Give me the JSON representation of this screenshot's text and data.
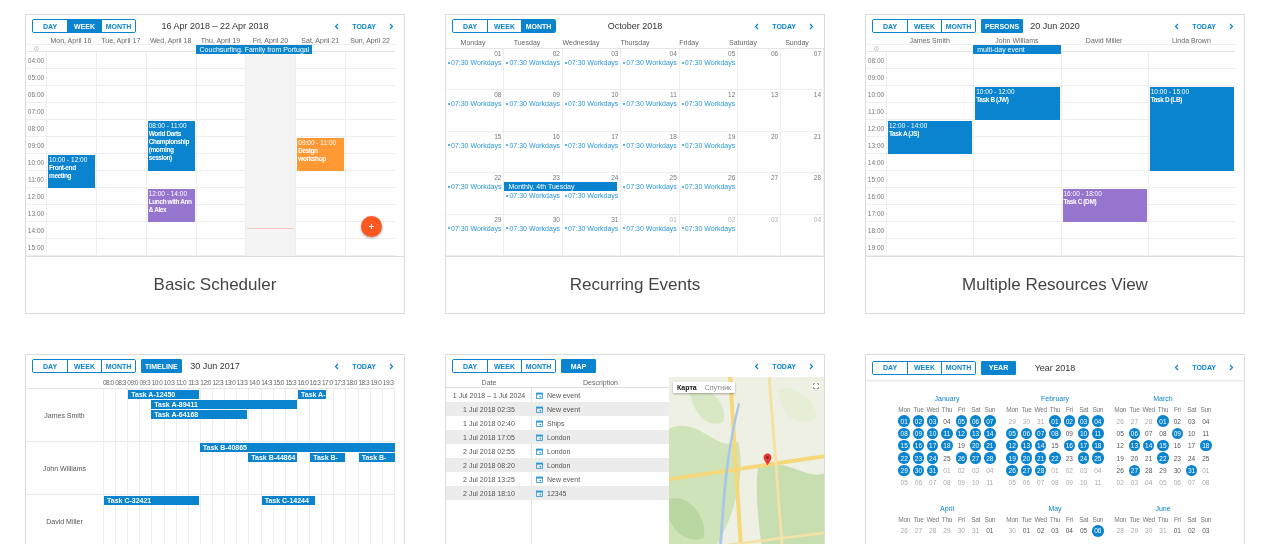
{
  "cards": [
    {
      "kind": "week",
      "caption": "Basic Scheduler",
      "toolbar": {
        "views": [
          {
            "label": "DAY",
            "selected": false
          },
          {
            "label": "WEEK",
            "selected": true
          },
          {
            "label": "MONTH",
            "selected": false
          }
        ],
        "title": "16 Apr 2018 – 22 Apr 2018",
        "today": "TODAY"
      },
      "hours": [
        "04:00",
        "05:00",
        "06:00",
        "07:00",
        "08:00",
        "09:00",
        "10:00",
        "11:00",
        "12:00",
        "13:00",
        "14:00",
        "15:00"
      ],
      "columns": [
        {
          "label": "Mon, April 16",
          "today": false,
          "events": [
            {
              "time": "10:00 - 12:00",
              "title": "Front-end meeting",
              "color": "#0a84cf"
            }
          ]
        },
        {
          "label": "Tue, April 17",
          "today": false
        },
        {
          "label": "Wed, April 18",
          "today": false,
          "events": [
            {
              "time": "08:00 - 11:00",
              "title": "World Darts Championship (morning session)",
              "color": "#0a84cf"
            },
            {
              "time": "12:00 - 14:00",
              "title": "Lunch with Ann & Alex",
              "color": "#9575cd"
            }
          ]
        },
        {
          "label": "Thu, April 19",
          "today": false,
          "all_day": [
            "Couchsurfing. Family from Portugal"
          ]
        },
        {
          "label": "Fri, April 20",
          "today": true
        },
        {
          "label": "Sat, April 21",
          "today": false,
          "events": [
            {
              "time": "09:00 - 11:00",
              "title": "Design workshop",
              "color": "#ff9933"
            }
          ]
        },
        {
          "label": "Sun, April 22",
          "today": false
        }
      ]
    },
    {
      "kind": "month",
      "caption": "Recurring Events",
      "toolbar": {
        "views": [
          {
            "label": "DAY",
            "selected": false
          },
          {
            "label": "WEEK",
            "selected": false
          },
          {
            "label": "MONTH",
            "selected": true
          }
        ],
        "title": "October 2018",
        "today": "TODAY"
      },
      "weekdays": [
        "Monday",
        "Tuesday",
        "Wednesday",
        "Thursday",
        "Friday",
        "Saturday",
        "Sunday"
      ],
      "weeks": [
        {
          "days": [
            {
              "number": "01",
              "muted": false,
              "events": [
                "07:30 Workdays"
              ]
            },
            {
              "number": "02",
              "muted": false,
              "events": [
                "07:30 Workdays"
              ]
            },
            {
              "number": "03",
              "muted": false,
              "events": [
                "07:30 Workdays"
              ]
            },
            {
              "number": "04",
              "muted": false,
              "events": [
                "07:30 Workdays"
              ]
            },
            {
              "number": "05",
              "muted": false,
              "events": [
                "07:30 Workdays"
              ]
            },
            {
              "number": "06",
              "muted": false
            },
            {
              "number": "07",
              "muted": false
            }
          ]
        },
        {
          "days": [
            {
              "number": "08",
              "muted": false,
              "events": [
                "07:30 Workdays"
              ]
            },
            {
              "number": "09",
              "muted": false,
              "events": [
                "07:30 Workdays"
              ]
            },
            {
              "number": "10",
              "muted": false,
              "events": [
                "07:30 Workdays"
              ]
            },
            {
              "number": "11",
              "muted": false,
              "events": [
                "07:30 Workdays"
              ]
            },
            {
              "number": "12",
              "muted": false,
              "events": [
                "07:30 Workdays"
              ]
            },
            {
              "number": "13",
              "muted": false
            },
            {
              "number": "14",
              "muted": false
            }
          ]
        },
        {
          "days": [
            {
              "number": "15",
              "muted": false,
              "events": [
                "07:30 Workdays"
              ]
            },
            {
              "number": "16",
              "muted": false,
              "events": [
                "07:30 Workdays"
              ]
            },
            {
              "number": "17",
              "muted": false,
              "events": [
                "07:30 Workdays"
              ]
            },
            {
              "number": "18",
              "muted": false,
              "events": [
                "07:30 Workdays"
              ]
            },
            {
              "number": "19",
              "muted": false,
              "events": [
                "07:30 Workdays"
              ]
            },
            {
              "number": "20",
              "muted": false
            },
            {
              "number": "21",
              "muted": false
            }
          ]
        },
        {
          "days": [
            {
              "number": "22",
              "muted": false,
              "events": [
                "07:30 Workdays"
              ]
            },
            {
              "number": "23",
              "muted": false,
              "bar": "Monthly, 4th Tuesday",
              "events": [
                "07:30 Workdays"
              ]
            },
            {
              "number": "24",
              "muted": false,
              "events": [
                "07:30 Workdays"
              ]
            },
            {
              "number": "25",
              "muted": false,
              "events": [
                "07:30 Workdays"
              ]
            },
            {
              "number": "26",
              "muted": false,
              "events": [
                "07:30 Workdays"
              ]
            },
            {
              "number": "27",
              "muted": false
            },
            {
              "number": "28",
              "muted": false
            }
          ]
        },
        {
          "days": [
            {
              "number": "29",
              "muted": false,
              "events": [
                "07:30 Workdays"
              ]
            },
            {
              "number": "30",
              "muted": false,
              "events": [
                "07:30 Workdays"
              ]
            },
            {
              "number": "31",
              "muted": false,
              "events": [
                "07:30 Workdays"
              ]
            },
            {
              "number": "01",
              "muted": true,
              "events": [
                "07:30 Workdays"
              ]
            },
            {
              "number": "02",
              "muted": true,
              "events": [
                "07:30 Workdays"
              ]
            },
            {
              "number": "03",
              "muted": true
            },
            {
              "number": "04",
              "muted": true
            }
          ]
        }
      ]
    },
    {
      "kind": "persons",
      "caption": "Multiple Resources View",
      "toolbar": {
        "views": [
          {
            "label": "DAY",
            "selected": false
          },
          {
            "label": "WEEK",
            "selected": false
          },
          {
            "label": "MONTH",
            "selected": false
          }
        ],
        "extra_view": {
          "label": "PERSONS",
          "selected": true
        },
        "title": "20 Jun 2020",
        "today": "TODAY"
      },
      "hours": [
        "08:00",
        "09:00",
        "10:00",
        "11:00",
        "12:00",
        "13:00",
        "14:00",
        "15:00",
        "16:00",
        "17:00",
        "18:00",
        "19:00"
      ],
      "columns": [
        {
          "label": "James Smith",
          "events": [
            {
              "time": "12:00 - 14:00",
              "title": "Task A (JS)",
              "color": "#0a84cf"
            }
          ]
        },
        {
          "label": "John Williams",
          "all_day": [
            "multi-day event"
          ],
          "events": [
            {
              "time": "10:00 - 12:00",
              "title": "Task B (JW)",
              "color": "#0a84cf"
            }
          ]
        },
        {
          "label": "David Miller",
          "events": [
            {
              "time": "16:00 - 18:00",
              "title": "Task C (DM)",
              "color": "#9575cd"
            }
          ]
        },
        {
          "label": "Linda Brown",
          "events": [
            {
              "time": "10:00 - 15:00",
              "title": "Task D (LB)",
              "color": "#0a84cf"
            }
          ]
        }
      ]
    },
    {
      "kind": "timeline",
      "toolbar": {
        "views": [
          {
            "label": "DAY",
            "selected": false
          },
          {
            "label": "WEEK",
            "selected": false
          },
          {
            "label": "MONTH",
            "selected": false
          }
        ],
        "extra_view": {
          "label": "TIMELINE",
          "selected": true
        },
        "title": "30 Jun 2017",
        "today": "TODAY"
      },
      "slots": [
        "08:0",
        "08:3",
        "09:0",
        "09:3",
        "10:0",
        "10:3",
        "11:0",
        "11:3",
        "12:0",
        "12:3",
        "13:0",
        "13:3",
        "14:0",
        "14:3",
        "15:0",
        "15:3",
        "16:0",
        "16:3",
        "17:0",
        "17:3",
        "18:0",
        "18:3",
        "19:0",
        "19:3"
      ],
      "resources": [
        {
          "name": "James Smith",
          "tasks": [
            "Task A-12450",
            "Task A-",
            "Task A-89411",
            "Task A-64168"
          ]
        },
        {
          "name": "John Williams",
          "tasks": [
            "Task B-40865",
            "Task B-44864",
            "Task B-",
            "Task B-"
          ]
        },
        {
          "name": "David Miller",
          "tasks": [
            "Task C-32421",
            "Task C-14244"
          ]
        }
      ]
    },
    {
      "kind": "map",
      "toolbar": {
        "views": [
          {
            "label": "DAY",
            "selected": false
          },
          {
            "label": "WEEK",
            "selected": false
          },
          {
            "label": "MONTH",
            "selected": false
          }
        ],
        "extra_view": {
          "label": "MAP",
          "selected": true
        },
        "today": "TODAY"
      },
      "columns": [
        "Date",
        "Description"
      ],
      "rows": [
        {
          "date": "1 Jul 2018 – 1 Jul 2024",
          "description": "New event"
        },
        {
          "date": "1 Jul 2018 02:35",
          "description": "New event"
        },
        {
          "date": "1 Jul 2018 02:40",
          "description": "Ships"
        },
        {
          "date": "1 Jul 2018 17:05",
          "description": "London"
        },
        {
          "date": "2 Jul 2018 02:55",
          "description": "London"
        },
        {
          "date": "2 Jul 2018 08:20",
          "description": "London"
        },
        {
          "date": "2 Jul 2018 13:25",
          "description": "New event"
        },
        {
          "date": "2 Jul 2018 18:10",
          "description": "12345"
        }
      ],
      "map": {
        "kind": "picture",
        "modes": [
          {
            "label": "Карта",
            "selected": true
          },
          {
            "label": "Спутник",
            "selected": false
          }
        ]
      }
    },
    {
      "kind": "year",
      "toolbar": {
        "views": [
          {
            "label": "DAY",
            "selected": false
          },
          {
            "label": "WEEK",
            "selected": false
          },
          {
            "label": "MONTH",
            "selected": false
          }
        ],
        "extra_view": {
          "label": "YEAR",
          "selected": true
        },
        "title": "Year 2018",
        "today": "TODAY"
      },
      "months": [
        {
          "name": "January",
          "weekdays": [
            "Mon",
            "Tue",
            "Wed",
            "Thu",
            "Fri",
            "Sat",
            "Sun"
          ],
          "weeks": [
            [
              {
                "day": "01",
                "marked": true,
                "muted": false
              },
              {
                "day": "02",
                "marked": true,
                "muted": false
              },
              {
                "day": "03",
                "marked": true,
                "muted": false
              },
              {
                "day": "04",
                "marked": false,
                "muted": false
              },
              {
                "day": "05",
                "marked": true,
                "muted": false
              },
              {
                "day": "06",
                "marked": true,
                "muted": false
              },
              {
                "day": "07",
                "marked": true,
                "muted": false
              }
            ],
            [
              {
                "day": "08",
                "marked": true,
                "muted": false
              },
              {
                "day": "09",
                "marked": true,
                "muted": false
              },
              {
                "day": "10",
                "marked": true,
                "muted": false
              },
              {
                "day": "11",
                "marked": true,
                "muted": false
              },
              {
                "day": "12",
                "marked": true,
                "muted": false
              },
              {
                "day": "13",
                "marked": true,
                "muted": false
              },
              {
                "day": "14",
                "marked": true,
                "muted": false
              }
            ],
            [
              {
                "day": "15",
                "marked": true,
                "muted": false
              },
              {
                "day": "16",
                "marked": true,
                "muted": false
              },
              {
                "day": "17",
                "marked": true,
                "muted": false
              },
              {
                "day": "18",
                "marked": true,
                "muted": false
              },
              {
                "day": "19",
                "marked": false,
                "muted": false
              },
              {
                "day": "20",
                "marked": true,
                "muted": false
              },
              {
                "day": "21",
                "marked": true,
                "muted": false
              }
            ],
            [
              {
                "day": "22",
                "marked": true,
                "muted": false
              },
              {
                "day": "23",
                "marked": true,
                "muted": false
              },
              {
                "day": "24",
                "marked": true,
                "muted": false
              },
              {
                "day": "25",
                "marked": false,
                "muted": false
              },
              {
                "day": "26",
                "marked": true,
                "muted": false
              },
              {
                "day": "27",
                "marked": true,
                "muted": false
              },
              {
                "day": "28",
                "marked": true,
                "muted": false
              }
            ],
            [
              {
                "day": "29",
                "marked": true,
                "muted": false
              },
              {
                "day": "30",
                "marked": true,
                "muted": false
              },
              {
                "day": "31",
                "marked": true,
                "muted": false
              },
              {
                "day": "01",
                "marked": false,
                "muted": true
              },
              {
                "day": "02",
                "marked": false,
                "muted": true
              },
              {
                "day": "03",
                "marked": false,
                "muted": true
              },
              {
                "day": "04",
                "marked": false,
                "muted": true
              }
            ],
            [
              {
                "day": "05",
                "marked": false,
                "muted": true
              },
              {
                "day": "06",
                "marked": false,
                "muted": true
              },
              {
                "day": "07",
                "marked": false,
                "muted": true
              },
              {
                "day": "08",
                "marked": false,
                "muted": true
              },
              {
                "day": "09",
                "marked": false,
                "muted": true
              },
              {
                "day": "10",
                "marked": false,
                "muted": true
              },
              {
                "day": "11",
                "marked": false,
                "muted": true
              }
            ]
          ]
        },
        {
          "name": "February",
          "weekdays": [
            "Mon",
            "Tue",
            "Wed",
            "Thu",
            "Fri",
            "Sat",
            "Sun"
          ],
          "weeks": [
            [
              {
                "day": "29",
                "marked": false,
                "muted": true
              },
              {
                "day": "30",
                "marked": false,
                "muted": true
              },
              {
                "day": "31",
                "marked": false,
                "muted": true
              },
              {
                "day": "01",
                "marked": true,
                "muted": false
              },
              {
                "day": "02",
                "marked": true,
                "muted": false
              },
              {
                "day": "03",
                "marked": true,
                "muted": false
              },
              {
                "day": "04",
                "marked": true,
                "muted": false
              }
            ],
            [
              {
                "day": "05",
                "marked": true,
                "muted": false
              },
              {
                "day": "06",
                "marked": true,
                "muted": false
              },
              {
                "day": "07",
                "marked": true,
                "muted": false
              },
              {
                "day": "08",
                "marked": true,
                "muted": false
              },
              {
                "day": "09",
                "marked": false,
                "muted": false
              },
              {
                "day": "10",
                "marked": true,
                "muted": false
              },
              {
                "day": "11",
                "marked": true,
                "muted": false
              }
            ],
            [
              {
                "day": "12",
                "marked": true,
                "muted": false
              },
              {
                "day": "13",
                "marked": true,
                "muted": false
              },
              {
                "day": "14",
                "marked": true,
                "muted": false
              },
              {
                "day": "15",
                "marked": false,
                "muted": false
              },
              {
                "day": "16",
                "marked": true,
                "muted": false
              },
              {
                "day": "17",
                "marked": true,
                "muted": false
              },
              {
                "day": "18",
                "marked": true,
                "muted": false
              }
            ],
            [
              {
                "day": "19",
                "marked": true,
                "muted": false
              },
              {
                "day": "20",
                "marked": true,
                "muted": false
              },
              {
                "day": "21",
                "marked": true,
                "muted": false
              },
              {
                "day": "22",
                "marked": true,
                "muted": false
              },
              {
                "day": "23",
                "marked": false,
                "muted": false
              },
              {
                "day": "24",
                "marked": true,
                "muted": false
              },
              {
                "day": "25",
                "marked": true,
                "muted": false
              }
            ],
            [
              {
                "day": "26",
                "marked": true,
                "muted": false
              },
              {
                "day": "27",
                "marked": true,
                "muted": false
              },
              {
                "day": "28",
                "marked": true,
                "muted": false
              },
              {
                "day": "01",
                "marked": false,
                "muted": true
              },
              {
                "day": "02",
                "marked": false,
                "muted": true
              },
              {
                "day": "03",
                "marked": false,
                "muted": true
              },
              {
                "day": "04",
                "marked": false,
                "muted": true
              }
            ],
            [
              {
                "day": "05",
                "marked": false,
                "muted": true
              },
              {
                "day": "06",
                "marked": false,
                "muted": true
              },
              {
                "day": "07",
                "marked": false,
                "muted": true
              },
              {
                "day": "08",
                "marked": false,
                "muted": true
              },
              {
                "day": "09",
                "marked": false,
                "muted": true
              },
              {
                "day": "10",
                "marked": false,
                "muted": true
              },
              {
                "day": "11",
                "marked": false,
                "muted": true
              }
            ]
          ]
        },
        {
          "name": "March",
          "weekdays": [
            "Mon",
            "Tue",
            "Wed",
            "Thu",
            "Fri",
            "Sat",
            "Sun"
          ],
          "weeks": [
            [
              {
                "day": "26",
                "marked": false,
                "muted": true
              },
              {
                "day": "27",
                "marked": false,
                "muted": true
              },
              {
                "day": "28",
                "marked": false,
                "muted": true
              },
              {
                "day": "01",
                "marked": true,
                "muted": false
              },
              {
                "day": "02",
                "marked": false,
                "muted": false
              },
              {
                "day": "03",
                "marked": false,
                "muted": false
              },
              {
                "day": "04",
                "marked": false,
                "muted": false
              }
            ],
            [
              {
                "day": "05",
                "marked": false,
                "muted": false
              },
              {
                "day": "06",
                "marked": true,
                "muted": false
              },
              {
                "day": "07",
                "marked": false,
                "muted": false
              },
              {
                "day": "08",
                "marked": false,
                "muted": false
              },
              {
                "day": "09",
                "marked": true,
                "muted": false
              },
              {
                "day": "10",
                "marked": false,
                "muted": false
              },
              {
                "day": "11",
                "marked": false,
                "muted": false
              }
            ],
            [
              {
                "day": "12",
                "marked": false,
                "muted": false
              },
              {
                "day": "13",
                "marked": true,
                "muted": false
              },
              {
                "day": "14",
                "marked": true,
                "muted": false
              },
              {
                "day": "15",
                "marked": true,
                "muted": false
              },
              {
                "day": "16",
                "marked": false,
                "muted": false
              },
              {
                "day": "17",
                "marked": false,
                "muted": false
              },
              {
                "day": "18",
                "marked": true,
                "muted": false
              }
            ],
            [
              {
                "day": "19",
                "marked": false,
                "muted": false
              },
              {
                "day": "20",
                "marked": false,
                "muted": false
              },
              {
                "day": "21",
                "marked": false,
                "muted": false
              },
              {
                "day": "22",
                "marked": true,
                "muted": false
              },
              {
                "day": "23",
                "marked": false,
                "muted": false
              },
              {
                "day": "24",
                "marked": false,
                "muted": false
              },
              {
                "day": "25",
                "marked": false,
                "muted": false
              }
            ],
            [
              {
                "day": "26",
                "marked": false,
                "muted": false
              },
              {
                "day": "27",
                "marked": true,
                "muted": false
              },
              {
                "day": "28",
                "marked": false,
                "muted": false
              },
              {
                "day": "29",
                "marked": false,
                "muted": false
              },
              {
                "day": "30",
                "marked": false,
                "muted": false
              },
              {
                "day": "31",
                "marked": true,
                "muted": false
              },
              {
                "day": "01",
                "marked": false,
                "muted": true
              }
            ],
            [
              {
                "day": "02",
                "marked": false,
                "muted": true
              },
              {
                "day": "03",
                "marked": false,
                "muted": true
              },
              {
                "day": "04",
                "marked": false,
                "muted": true
              },
              {
                "day": "05",
                "marked": false,
                "muted": true
              },
              {
                "day": "06",
                "marked": false,
                "muted": true
              },
              {
                "day": "07",
                "marked": false,
                "muted": true
              },
              {
                "day": "08",
                "marked": false,
                "muted": true
              }
            ]
          ]
        },
        {
          "name": "April",
          "weekdays": [
            "Mon",
            "Tue",
            "Wed",
            "Thu",
            "Fri",
            "Sat",
            "Sun"
          ],
          "weeks": [
            [
              {
                "day": "26",
                "marked": false,
                "muted": true
              },
              {
                "day": "27",
                "marked": false,
                "muted": true
              },
              {
                "day": "28",
                "marked": false,
                "muted": true
              },
              {
                "day": "29",
                "marked": false,
                "muted": true
              },
              {
                "day": "30",
                "marked": false,
                "muted": true
              },
              {
                "day": "31",
                "marked": false,
                "muted": true
              },
              {
                "day": "01",
                "marked": false,
                "muted": false
              }
            ]
          ]
        },
        {
          "name": "May",
          "weekdays": [
            "Mon",
            "Tue",
            "Wed",
            "Thu",
            "Fri",
            "Sat",
            "Sun"
          ],
          "weeks": [
            [
              {
                "day": "30",
                "marked": false,
                "muted": true
              },
              {
                "day": "01",
                "marked": false,
                "muted": false
              },
              {
                "day": "02",
                "marked": false,
                "muted": false
              },
              {
                "day": "03",
                "marked": false,
                "muted": false
              },
              {
                "day": "04",
                "marked": false,
                "muted": false
              },
              {
                "day": "05",
                "marked": false,
                "muted": false
              },
              {
                "day": "06",
                "marked": true,
                "muted": false
              }
            ]
          ]
        },
        {
          "name": "June",
          "weekdays": [
            "Mon",
            "Tue",
            "Wed",
            "Thu",
            "Fri",
            "Sat",
            "Sun"
          ],
          "weeks": [
            [
              {
                "day": "28",
                "marked": false,
                "muted": true
              },
              {
                "day": "29",
                "marked": false,
                "muted": true
              },
              {
                "day": "30",
                "marked": false,
                "muted": true
              },
              {
                "day": "31",
                "marked": false,
                "muted": true
              },
              {
                "day": "01",
                "marked": false,
                "muted": false
              },
              {
                "day": "02",
                "marked": false,
                "muted": false
              },
              {
                "day": "03",
                "marked": false,
                "muted": false
              }
            ]
          ]
        }
      ]
    }
  ]
}
